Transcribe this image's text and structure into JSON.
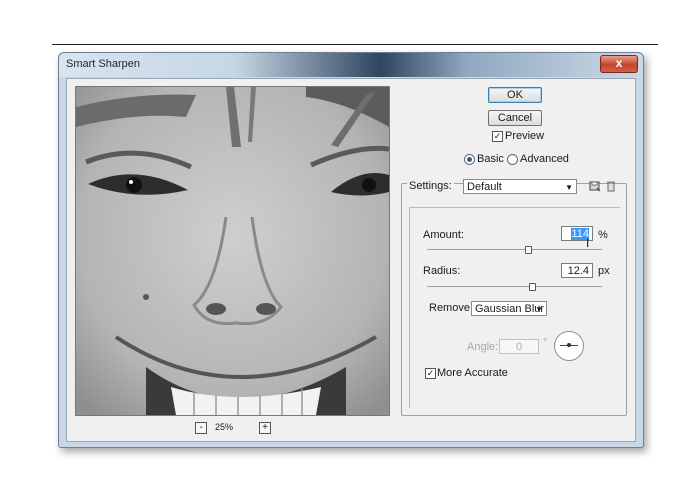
{
  "dialog": {
    "title": "Smart Sharpen",
    "close_glyph": "x"
  },
  "buttons": {
    "ok": "OK",
    "cancel": "Cancel"
  },
  "preview": {
    "label": "Preview",
    "checked": true,
    "zoom": "25%",
    "zoom_out": "-",
    "zoom_in": "+"
  },
  "mode": {
    "basic": "Basic",
    "advanced": "Advanced",
    "selected": "Basic"
  },
  "settings": {
    "label": "Settings:",
    "value": "Default",
    "icons": [
      "save-settings-icon",
      "delete-settings-icon"
    ]
  },
  "amount": {
    "label": "Amount:",
    "value": "114",
    "unit": "%",
    "slider_position": 0.56
  },
  "radius": {
    "label": "Radius:",
    "value": "12.4",
    "unit": "px",
    "slider_position": 0.58
  },
  "remove": {
    "label": "Remove:",
    "value": "Gaussian Blur"
  },
  "angle": {
    "label": "Angle:",
    "value": "0",
    "unit": "°"
  },
  "more_accurate": {
    "label": "More Accurate",
    "checked": true
  }
}
